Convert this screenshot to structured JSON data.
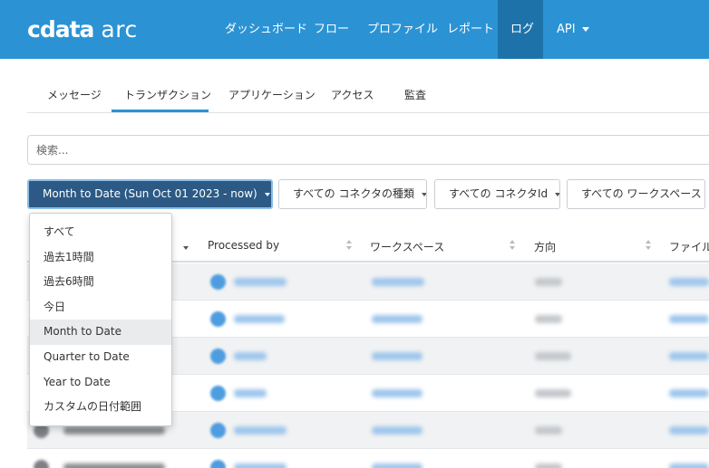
{
  "header": {
    "logo_brand": "cdata",
    "logo_product": "arc",
    "nav": [
      {
        "label": "ダッシュボード"
      },
      {
        "label": "フロー"
      },
      {
        "label": "プロファイル"
      },
      {
        "label": "レポート"
      },
      {
        "label": "ログ",
        "active": true
      },
      {
        "label": "API",
        "has_dropdown": true
      }
    ]
  },
  "tabs": [
    {
      "label": "メッセージ"
    },
    {
      "label": "トランザクション",
      "active": true
    },
    {
      "label": "アプリケーション"
    },
    {
      "label": "アクセス"
    },
    {
      "label": "監査"
    }
  ],
  "search": {
    "placeholder": "検索..."
  },
  "filters": {
    "date": "Month to Date (Sun Oct 01 2023 - now)",
    "connector_type": "すべての コネクタの種類",
    "connector_id": "すべての コネクタId",
    "workspace": "すべての ワークスペース"
  },
  "table": {
    "columns": [
      {
        "label": "",
        "sort": "desc"
      },
      {
        "label": "Processed by"
      },
      {
        "label": "ワークスペース"
      },
      {
        "label": "方向"
      },
      {
        "label": "ファイル名"
      }
    ],
    "row_count": 6
  },
  "date_menu": {
    "items": [
      {
        "label": "すべて"
      },
      {
        "label": "過去1時間"
      },
      {
        "label": "過去6時間"
      },
      {
        "label": "今日"
      },
      {
        "label": "Month to Date",
        "highlighted": true
      },
      {
        "label": "Quarter to Date"
      },
      {
        "label": "Year to Date"
      },
      {
        "label": "カスタムの日付範囲"
      }
    ]
  },
  "colors": {
    "header_bg": "#2b93d4",
    "nav_active_bg": "#1d73a9",
    "primary_button_bg": "#2c5a85",
    "tab_underline": "#2b93d4"
  }
}
